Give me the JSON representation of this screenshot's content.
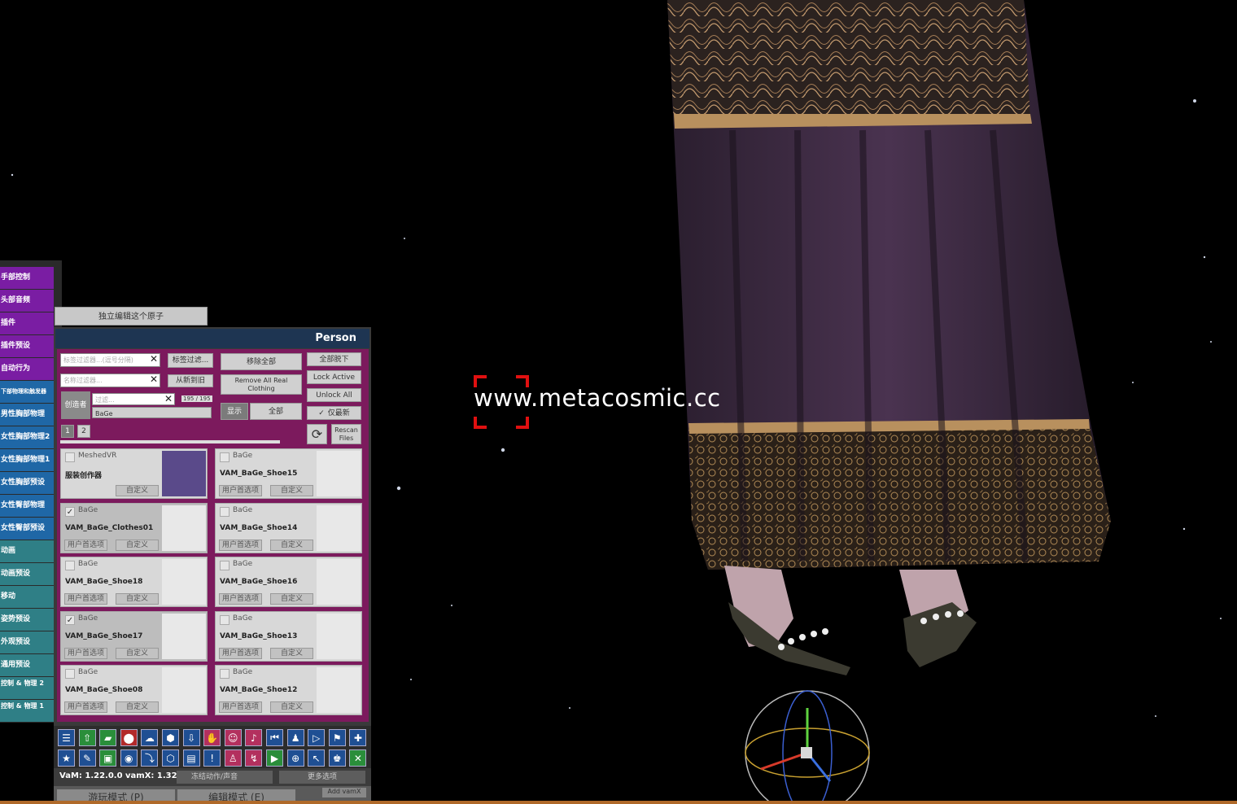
{
  "sidebar": {
    "items": [
      {
        "label": "手部控制",
        "color": "purple"
      },
      {
        "label": "头部音频",
        "color": "purple"
      },
      {
        "label": "插件",
        "color": "purple"
      },
      {
        "label": "插件预设",
        "color": "purple"
      },
      {
        "label": "自动行为",
        "color": "purple"
      },
      {
        "label": "下部物理和触发器",
        "color": "blue"
      },
      {
        "label": "男性胸部物理",
        "color": "blue"
      },
      {
        "label": "女性胸部物理2",
        "color": "blue"
      },
      {
        "label": "女性胸部物理1",
        "color": "blue"
      },
      {
        "label": "女性胸部预设",
        "color": "blue"
      },
      {
        "label": "女性臀部物理",
        "color": "blue"
      },
      {
        "label": "女性臀部预设",
        "color": "blue"
      },
      {
        "label": "动画",
        "color": "teal"
      },
      {
        "label": "动画预设",
        "color": "teal"
      },
      {
        "label": "移动",
        "color": "teal"
      },
      {
        "label": "姿势预设",
        "color": "teal"
      },
      {
        "label": "外观预设",
        "color": "teal"
      },
      {
        "label": "通用预设",
        "color": "teal"
      },
      {
        "label": "控制 & 物理 2",
        "color": "teal"
      },
      {
        "label": "控制 & 物理 1",
        "color": "teal"
      }
    ]
  },
  "edit_tab": "独立编辑这个原子",
  "panel": {
    "title": "Person",
    "tag_filter_placeholder": "标签过滤器...(逗号分隔)",
    "name_filter_placeholder": "名称过滤器...",
    "tag_filter_button": "标签过滤...",
    "sort_button": "从新到旧",
    "remove_all": "移除全部",
    "remove_all_real": "Remove All Real Clothing",
    "undress_all": "全部脱下",
    "lock_active": "Lock Active",
    "unlock_all": "Unlock All",
    "active_only": "仅最新",
    "creator_label": "创造者",
    "creator_filter_placeholder": "过滤...",
    "creator_count": "195 / 195",
    "creator_value": "BaGe",
    "show_label": "显示",
    "show_value": "全部",
    "rescan": "Rescan Files",
    "pages": [
      "1",
      "2"
    ],
    "items": [
      {
        "creator": "MeshedVR",
        "name": "服装创作器",
        "checked": false,
        "btn1": "",
        "btn2": "自定义"
      },
      {
        "creator": "BaGe",
        "name": "VAM_BaGe_Shoe15",
        "checked": false,
        "btn1": "用户首选项",
        "btn2": "自定义"
      },
      {
        "creator": "BaGe",
        "name": "VAM_BaGe_Clothes01",
        "checked": true,
        "btn1": "用户首选项",
        "btn2": "自定义"
      },
      {
        "creator": "BaGe",
        "name": "VAM_BaGe_Shoe14",
        "checked": false,
        "btn1": "用户首选项",
        "btn2": "自定义"
      },
      {
        "creator": "BaGe",
        "name": "VAM_BaGe_Shoe18",
        "checked": false,
        "btn1": "用户首选项",
        "btn2": "自定义"
      },
      {
        "creator": "BaGe",
        "name": "VAM_BaGe_Shoe16",
        "checked": false,
        "btn1": "用户首选项",
        "btn2": "自定义"
      },
      {
        "creator": "BaGe",
        "name": "VAM_BaGe_Shoe17",
        "checked": true,
        "btn1": "用户首选项",
        "btn2": "自定义"
      },
      {
        "creator": "BaGe",
        "name": "VAM_BaGe_Shoe13",
        "checked": false,
        "btn1": "用户首选项",
        "btn2": "自定义"
      },
      {
        "creator": "BaGe",
        "name": "VAM_BaGe_Shoe08",
        "checked": false,
        "btn1": "用户首选项",
        "btn2": "自定义"
      },
      {
        "creator": "BaGe",
        "name": "VAM_BaGe_Shoe12",
        "checked": false,
        "btn1": "用户首选项",
        "btn2": "自定义"
      }
    ]
  },
  "toolbar": {
    "version": "VaM: 1.22.0.0 vamX: 1.32",
    "freeze": "冻结动作/声音",
    "more_options": "更多选项",
    "play_mode": "游玩模式 (P)",
    "edit_mode": "编辑模式 (E)",
    "add_vamx": "Add vamX"
  },
  "watermark": "www.metacosmic.cc"
}
